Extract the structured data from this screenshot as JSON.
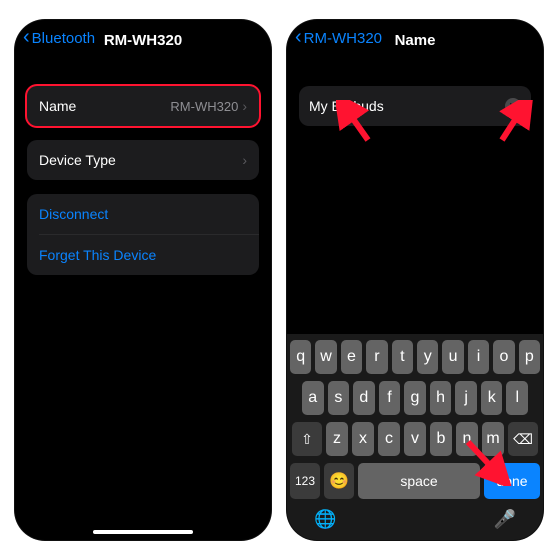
{
  "left": {
    "nav": {
      "back": "Bluetooth",
      "title": "RM-WH320"
    },
    "name_row": {
      "label": "Name",
      "value": "RM-WH320"
    },
    "device_type_row": {
      "label": "Device Type"
    },
    "disconnect": "Disconnect",
    "forget": "Forget This Device"
  },
  "right": {
    "nav": {
      "back": "RM-WH320",
      "title": "Name"
    },
    "input_value": "My Earbuds",
    "keyboard": {
      "row1": [
        "q",
        "w",
        "e",
        "r",
        "t",
        "y",
        "u",
        "i",
        "o",
        "p"
      ],
      "row2": [
        "a",
        "s",
        "d",
        "f",
        "g",
        "h",
        "j",
        "k",
        "l"
      ],
      "row3": [
        "z",
        "x",
        "c",
        "v",
        "b",
        "n",
        "m"
      ],
      "numbers": "123",
      "space": "space",
      "done": "done",
      "shift": "⇧",
      "backspace": "⌫",
      "emoji": "😊",
      "globe": "🌐",
      "mic": "🎤"
    }
  }
}
